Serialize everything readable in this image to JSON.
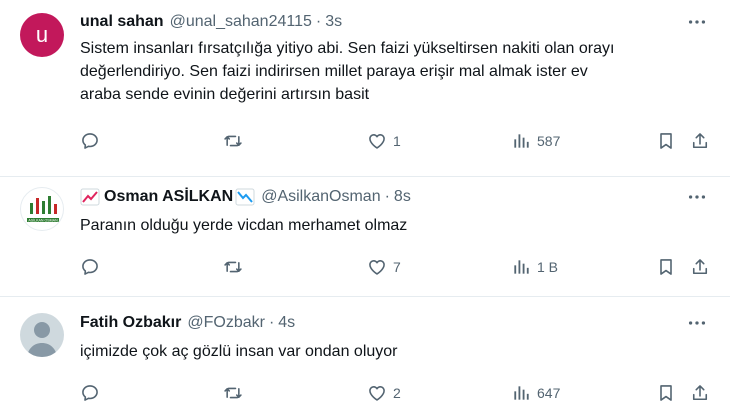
{
  "tweets": [
    {
      "avatar_letter": "u",
      "name": "unal sahan",
      "handle": "@unal_sahan24115",
      "separator": "·",
      "time": "3s",
      "text_lines": [
        "Sistem insanları fırsatçılığa yitiyo abi. Sen faizi yükseltirsen nakiti olan orayı",
        "değerlendiriyo. Sen faizi indirirsen millet paraya erişir mal almak ister ev",
        "araba  sende evinin değerini artırsın basit"
      ],
      "likes": "1",
      "views": "587"
    },
    {
      "name": "Osman ASİLKAN",
      "handle": "@AsilkanOsman",
      "separator": "·",
      "time": "8s",
      "text_lines": [
        "Paranın olduğu yerde vicdan merhamet olmaz"
      ],
      "likes": "7",
      "views": "1 B",
      "avatar_logo_text": "ASİLKAN OSMAN"
    },
    {
      "name": "Fatih Ozbakır",
      "handle": "@FOzbakr",
      "separator": "·",
      "time": "4s",
      "text_lines": [
        "içimizde çok aç gözlü insan var ondan oluyor"
      ],
      "likes": "2",
      "views": "647"
    }
  ],
  "icons": [
    "more-icon",
    "reply-icon",
    "retweet-icon",
    "like-icon",
    "views-icon",
    "bookmark-icon",
    "share-icon",
    "chart-up-emoji",
    "chart-down-emoji"
  ],
  "colors": {
    "text": "#0f1419",
    "secondary": "#536471",
    "divider": "#e6ecf0",
    "avatar_u": "#c2185b"
  }
}
